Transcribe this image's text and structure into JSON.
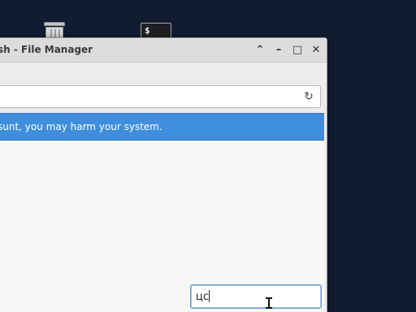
{
  "window": {
    "title": "sh - File Manager"
  },
  "warning": {
    "text": "sunt, you may harm your system."
  },
  "search": {
    "value": "цс"
  },
  "desktop": {
    "terminal_icon_glyph": "$"
  },
  "icons": {
    "trash": "trash-icon",
    "terminal": "terminal-icon",
    "reload": "reload-icon",
    "scroll_up": "chevron-up-icon",
    "minimize": "minimize-icon",
    "maximize": "maximize-icon",
    "close": "close-icon"
  },
  "colors": {
    "desktop_bg": "#121c30",
    "warning_bg": "#3f8ede",
    "window_bg": "#ececec"
  }
}
